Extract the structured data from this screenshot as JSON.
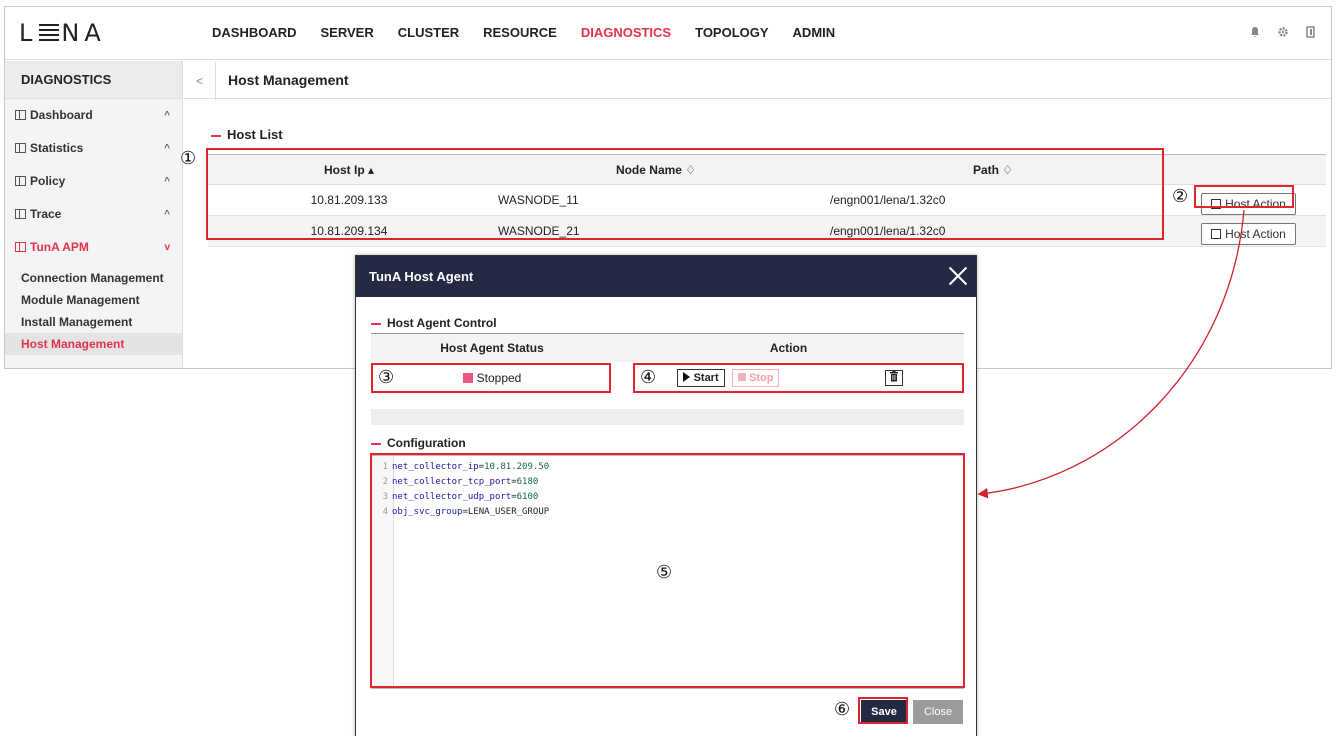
{
  "app": {
    "logo_left": "L",
    "logo_right": "NA",
    "nav": [
      "DASHBOARD",
      "SERVER",
      "CLUSTER",
      "RESOURCE",
      "DIAGNOSTICS",
      "TOPOLOGY",
      "ADMIN"
    ],
    "active_nav_index": 4,
    "accent_color": "#e0334d",
    "icons": [
      "bell-icon",
      "gear-icon",
      "logout-icon"
    ]
  },
  "sidebar": {
    "title": "DIAGNOSTICS",
    "items": [
      {
        "label": "Dashboard",
        "chevron": "^"
      },
      {
        "label": "Statistics",
        "chevron": "^"
      },
      {
        "label": "Policy",
        "chevron": "^"
      },
      {
        "label": "Trace",
        "chevron": "^"
      },
      {
        "label": "TunA APM",
        "chevron": "v"
      }
    ],
    "submenu": [
      "Connection Management",
      "Module Management",
      "Install Management",
      "Host Management"
    ]
  },
  "breadcrumb": {
    "back": "<",
    "title": "Host Management"
  },
  "host_list": {
    "title": "Host List",
    "columns": [
      "Host Ip ▴",
      "Node Name ♢",
      "Path ♢"
    ],
    "rows": [
      {
        "ip": "10.81.209.133",
        "node": "WASNODE_11",
        "path": "/engn001/lena/1.32c0",
        "action": "Host Action"
      },
      {
        "ip": "10.81.209.134",
        "node": "WASNODE_21",
        "path": "/engn001/lena/1.32c0",
        "action": "Host Action"
      }
    ]
  },
  "modal": {
    "title": "TunA Host Agent",
    "control_title": "Host Agent Control",
    "status_header": "Host Agent Status",
    "action_header": "Action",
    "status": "Stopped",
    "start_label": "Start",
    "stop_label": "Stop",
    "trash": "🗑",
    "config_title": "Configuration",
    "config_lines": [
      {
        "n": "1",
        "key": "net_collector_ip",
        "val": "10.81.209.50"
      },
      {
        "n": "2",
        "key": "net_collector_tcp_port",
        "val": "6180"
      },
      {
        "n": "3",
        "key": "net_collector_udp_port",
        "val": "6100"
      },
      {
        "n": "4",
        "key": "obj_svc_group",
        "val": "LENA_USER_GROUP"
      }
    ],
    "save_label": "Save",
    "close_label": "Close"
  },
  "annotations": [
    "①",
    "②",
    "③",
    "④",
    "⑤",
    "⑥"
  ]
}
